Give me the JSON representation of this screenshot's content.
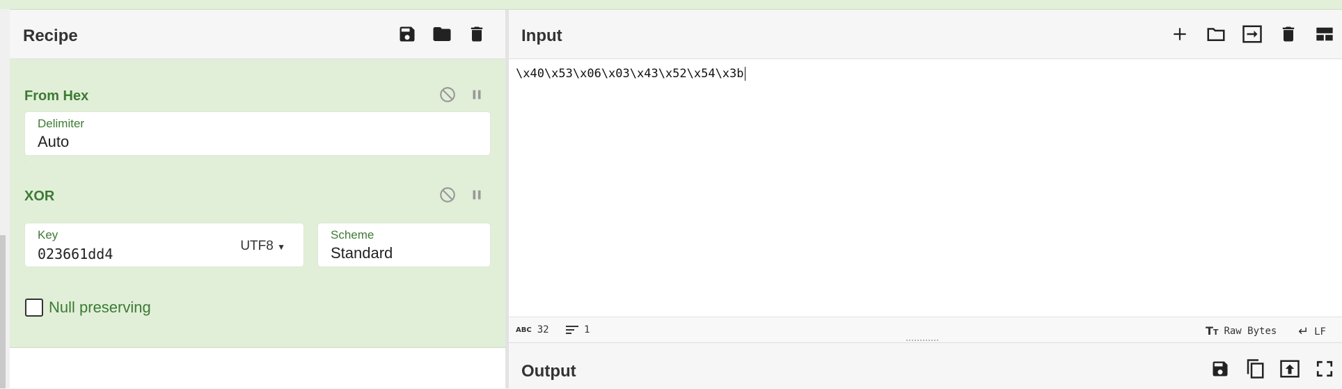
{
  "recipe": {
    "title": "Recipe",
    "operations": [
      {
        "name": "From Hex",
        "fields": [
          {
            "label": "Delimiter",
            "value": "Auto"
          }
        ]
      },
      {
        "name": "XOR",
        "fields": [
          {
            "label": "Key",
            "value": "023661dd4",
            "encoding": "UTF8"
          },
          {
            "label": "Scheme",
            "value": "Standard"
          }
        ],
        "checkbox": {
          "label": "Null preserving",
          "checked": false
        }
      }
    ]
  },
  "input": {
    "title": "Input",
    "text": "\\x40\\x53\\x06\\x03\\x43\\x52\\x54\\x3b",
    "status": {
      "length": "32",
      "lines": "1",
      "format": "Raw Bytes",
      "eol": "LF"
    }
  },
  "output": {
    "title": "Output"
  },
  "colors": {
    "accent_green": "#3d7a34",
    "op_background": "#e1efd8",
    "topbar": "#e2efd9"
  }
}
